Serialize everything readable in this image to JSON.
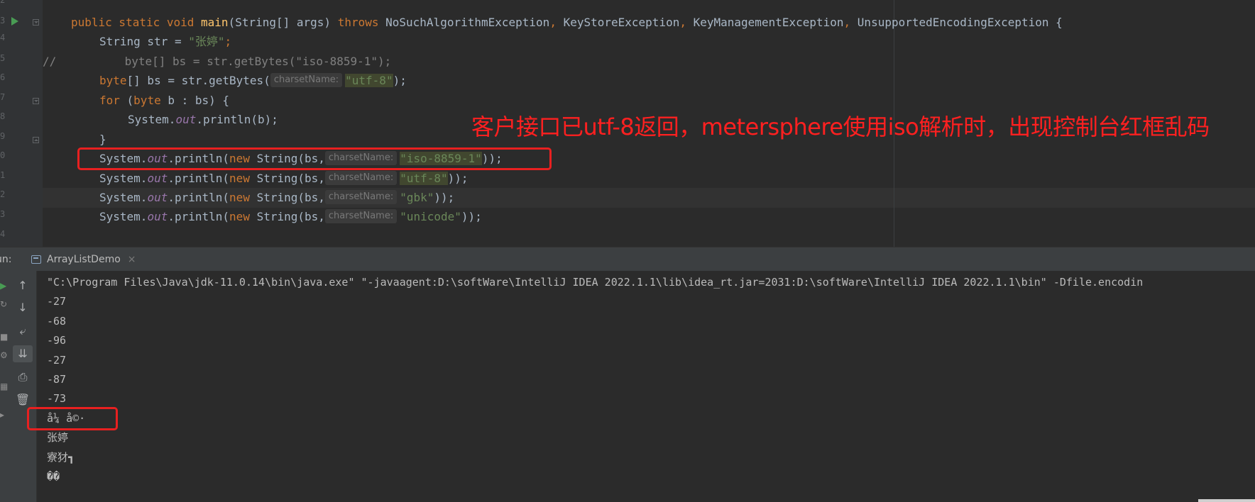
{
  "editor": {
    "line_numbers": [
      "2",
      "3",
      "4",
      "5",
      "6",
      "7",
      "8",
      "9",
      "0",
      "1",
      "2",
      "3",
      "4"
    ],
    "code": {
      "l_main": {
        "kw1": "public static void ",
        "fn": "main",
        "p1": "(String[] args) ",
        "kw2": "throws ",
        "p2": "NoSuchAlgorithmException",
        "c1": ", ",
        "p3": "KeyStoreException",
        "c2": ", ",
        "p4": "KeyManagementException",
        "c3": ", ",
        "p5": "UnsupportedEncodingException {"
      },
      "l_str": {
        "p1": "String str = ",
        "s": "\"张婷\"",
        "p2": ";"
      },
      "l_cmt": {
        "slashes": "//",
        "rest": "byte[] bs = str.getBytes(\"iso-8859-1\");"
      },
      "l_bytes": {
        "kw": "byte",
        "p1": "[] bs = str.getBytes(",
        "hint": "charsetName:",
        "s": "\"utf-8\"",
        "p2": ");"
      },
      "l_for": {
        "kw": "for ",
        "p1": "(",
        "kw2": "byte ",
        "p2": "b : bs) {"
      },
      "l_print_b": {
        "p1": "System.",
        "f": "out",
        "p2": ".println(b);"
      },
      "l_close": {
        "p": "}"
      },
      "l_iso": {
        "p1": "System.",
        "f": "out",
        "p2": ".println(",
        "kw": "new ",
        "p3": "String(bs,",
        "hint": "charsetName:",
        "s": "\"iso-8859-1\"",
        "p4": "));"
      },
      "l_utf": {
        "p1": "System.",
        "f": "out",
        "p2": ".println(",
        "kw": "new ",
        "p3": "String(bs,",
        "hint": "charsetName:",
        "s": "\"utf-8\"",
        "p4": "));"
      },
      "l_gbk": {
        "p1": "System.",
        "f": "out",
        "p2": ".println(",
        "kw": "new ",
        "p3": "String(bs,",
        "hint": "charsetName:",
        "s": "\"gbk\"",
        "p4": "));"
      },
      "l_uni": {
        "p1": "System.",
        "f": "out",
        "p2": ".println(",
        "kw": "new ",
        "p3": "String(bs,",
        "hint": "charsetName:",
        "s": "\"unicode\"",
        "p4": "));"
      }
    },
    "annotation": "客户接口已utf-8返回，metersphere使用iso解析时，出现控制台红框乱码"
  },
  "run_panel": {
    "label": "un:",
    "tab_label": "ArrayListDemo",
    "close_glyph": "×"
  },
  "console": {
    "command": "\"C:\\Program Files\\Java\\jdk-11.0.14\\bin\\java.exe\" \"-javaagent:D:\\softWare\\IntelliJ IDEA 2022.1.1\\lib\\idea_rt.jar=2031:D:\\softWare\\IntelliJ IDEA 2022.1.1\\bin\" -Dfile.encodin",
    "lines": [
      "-27",
      "-68",
      "-96",
      "-27",
      "-87",
      "-73",
      "å¼ å©·",
      "张婷",
      "寮犲┓",
      "��"
    ]
  },
  "toolbar": {
    "icons": [
      "arrow-up-icon",
      "arrow-down-icon",
      "soft-wrap-icon",
      "scroll-to-end-icon",
      "print-icon",
      "trash-icon"
    ],
    "glyphs": [
      "↑",
      "↓",
      "⤶",
      "⇊",
      "⎙",
      "🗑"
    ]
  },
  "colors": {
    "background": "#2b2b2b",
    "keyword": "#cc7832",
    "string": "#6a8759",
    "method": "#ffc66d",
    "field": "#9876aa",
    "annotation": "#ff2020"
  }
}
